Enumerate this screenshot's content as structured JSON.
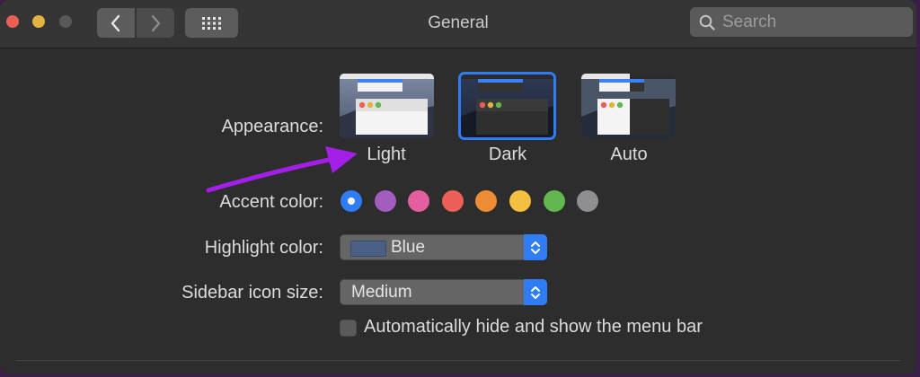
{
  "window": {
    "title": "General",
    "search": {
      "placeholder": "Search",
      "value": ""
    }
  },
  "appearance": {
    "label": "Appearance:",
    "options": [
      {
        "label": "Light",
        "selected": false
      },
      {
        "label": "Dark",
        "selected": true
      },
      {
        "label": "Auto",
        "selected": false
      }
    ]
  },
  "accent_color": {
    "label": "Accent color:",
    "colors": [
      "#2f7cf4",
      "#a35dbf",
      "#e35f9e",
      "#ec5f57",
      "#ef8b34",
      "#f3c13f",
      "#62b74d",
      "#8e8e93"
    ],
    "selected_index": 0
  },
  "highlight_color": {
    "label": "Highlight color:",
    "value": "Blue",
    "swatch": "#4a5f86"
  },
  "sidebar_icon_size": {
    "label": "Sidebar icon size:",
    "value": "Medium"
  },
  "menu_bar": {
    "label": "Automatically hide and show the menu bar",
    "checked": false
  },
  "colors": {
    "accent": "#2f7cf4",
    "annotation_arrow": "#a31ee6"
  }
}
